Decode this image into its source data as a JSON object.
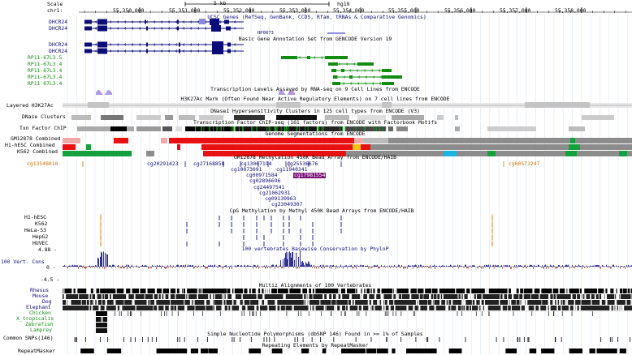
{
  "header": {
    "scale_label": "Scale",
    "chrom_label": "chr1:",
    "scale_text": "5 kb",
    "assembly": "hg19",
    "ruler_ticks": [
      "55,350,000",
      "55,351,000",
      "55,352,000",
      "55,353,000",
      "55,354,000",
      "55,355,000",
      "55,356,000",
      "55,357,000",
      "55,358,000"
    ]
  },
  "tracks": {
    "ucsc_genes": {
      "title": "UCSC Genes (RefSeq, GenBank, CCDS, Rfam, tRNAs & Comparative Genomics)",
      "rows": [
        "DHCR24",
        "DHCR24"
      ],
      "extra_label": "HP0873"
    },
    "gencode": {
      "title": "Basic Gene Annotation Set from GENCODE Version 19",
      "rows": [
        "DHCR24",
        "DHCR24",
        "RP11-67L3.5",
        "RP11-67L3.4",
        "RP11-67L3.4",
        "RP11-67L3.4",
        "RP11-67L3.4"
      ]
    },
    "txn_levels": {
      "title": "Transcription Levels Assayed by RNA-seq on 9 Cell Lines from ENCODE"
    },
    "h3k27ac": {
      "title": "H3K27Ac Mark (Often Found Near Active Regulatory Elements) on 7 cell lines from ENCODE",
      "label": "Layered H3K27Ac"
    },
    "dnase": {
      "title": "DNaseI Hypersensitivity Clusters in 125 cell types from ENCODE (V3)",
      "label": "DNase Clusters"
    },
    "tfbs": {
      "title": "Transcription Factor ChIP-seq (161 factors) from ENCODE with Factorbook Motifs",
      "label": "Txn Factor ChIP"
    },
    "segmentation": {
      "title": "Genome Segmentations from ENCODE",
      "rows": [
        "GM12878 Combined",
        "H1-hESC Combined",
        "K562 Combined"
      ]
    },
    "methyl450_gm": {
      "title": "GM12878 Methylation 450K Bead Array from ENCODE/HAIB",
      "probes": [
        "cg13548010",
        "cg20291423",
        "cg27168858",
        "cg13067194",
        "cg25536676",
        "cg10073091",
        "cg11940341",
        "cg00971584",
        "cg17981554",
        "cg02896696",
        "cg24497541",
        "cg21062931",
        "cg09130963",
        "cg23049307",
        "cg00573247"
      ]
    },
    "methyl450": {
      "title": "CpG Methylation by Methyl 450K Bead Arrays from ENCODE/HAIB",
      "rows": [
        "H1-hESC",
        "K562",
        "HeLa-S3",
        "HepG2",
        "HUVEC"
      ]
    },
    "conservation": {
      "title": "100 vertebrates Basewise Conservation by PhyloP",
      "label": "100 Vert. Cons",
      "max": "4.88 -",
      "zero": "0 -",
      "min": "-4.5 -"
    },
    "multiz": {
      "title": "Multiz Alignments of 100 Vertebrates",
      "rows": [
        "Rhesus",
        "Mouse",
        "Dog",
        "Elephant",
        "Chicken",
        "X_tropicalis",
        "Zebrafish",
        "Lamprey"
      ]
    },
    "snp": {
      "title": "Simple Nucleotide Polymorphisms (dbSNP 146) Found in >= 1% of Samples",
      "label": "Common SNPs(146)"
    },
    "repeats": {
      "title": "Repeating Elements by RepeatMasker",
      "label": "RepeatMasker"
    }
  },
  "colors": {
    "gene": "#0c0c78",
    "gencode_lnc": "#128c12",
    "strong_enhancer": "#e81010",
    "promoter": "#f0a8a8",
    "weak_enhancer": "#f5c016",
    "transcribed": "#14a03c",
    "insulator": "#19b4e0",
    "repressed": "#8c8c8c",
    "conservation": "#1a1a8a",
    "methyl_highlight": "#7a1478",
    "probe_orange": "#d0730a"
  }
}
